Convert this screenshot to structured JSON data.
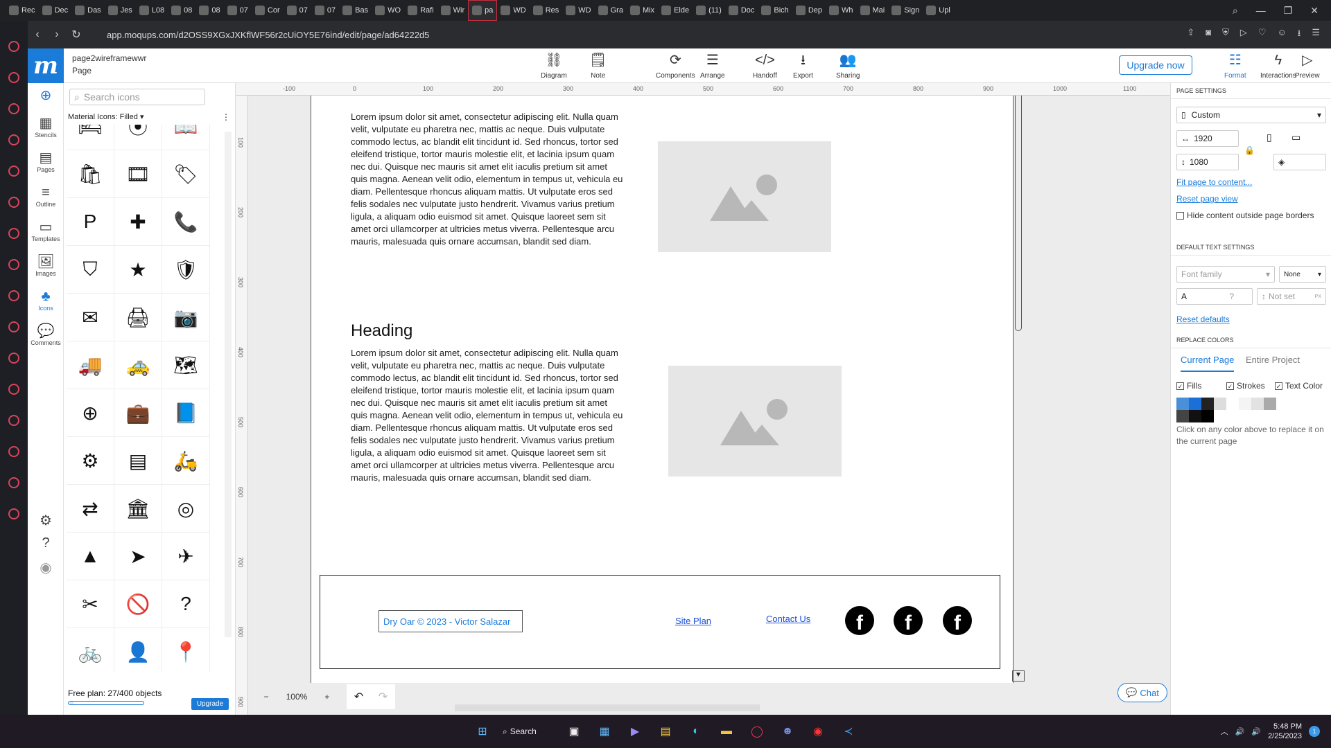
{
  "browser": {
    "tabs": [
      "Rec",
      "Dec",
      "Das",
      "Jes",
      "L08",
      "08",
      "08",
      "07",
      "Cor",
      "07",
      "07",
      "Bas",
      "WO",
      "Rafi",
      "Wir",
      "pa",
      "WD",
      "Res",
      "WD",
      "Gra",
      "Mix",
      "Elde",
      "(11)",
      "Doc",
      "Bich",
      "Dep",
      "Wh",
      "Mai",
      "Sign",
      "Upl"
    ],
    "active_tab_index": 15,
    "url": "app.moqups.com/d2OSS9XGxJXKflWF56r2cUiOY5E76ind/edit/page/ad64222d5"
  },
  "app": {
    "logo": "m",
    "project_name": "page2wireframewwr",
    "page_label": "Page",
    "toolbar": [
      {
        "label": "Diagram",
        "icon": "⛓"
      },
      {
        "label": "Note",
        "icon": "🗒"
      },
      {
        "label": "Components",
        "icon": "⟳"
      },
      {
        "label": "Arrange",
        "icon": "☰"
      },
      {
        "label": "Handoff",
        "icon": "</>"
      },
      {
        "label": "Export",
        "icon": "⭳"
      },
      {
        "label": "Sharing",
        "icon": "👥"
      }
    ],
    "upgrade_button": "Upgrade now",
    "right_tools": [
      {
        "label": "Format",
        "icon": "☷"
      },
      {
        "label": "Interactions",
        "icon": "ϟ"
      },
      {
        "label": "Preview",
        "icon": "▷"
      }
    ]
  },
  "rail": {
    "items": [
      {
        "label": "Stencils",
        "icon": "▦"
      },
      {
        "label": "Pages",
        "icon": "▤"
      },
      {
        "label": "Outline",
        "icon": "≡"
      },
      {
        "label": "Templates",
        "icon": "▭"
      },
      {
        "label": "Images",
        "icon": "🖼"
      },
      {
        "label": "Icons",
        "icon": "♣"
      },
      {
        "label": "Comments",
        "icon": "💬"
      }
    ]
  },
  "icon_panel": {
    "search_placeholder": "Search icons",
    "library": "Material Icons: Filled",
    "icons": [
      "🛏",
      "⦿",
      "📖",
      "🛍",
      "🎞",
      "🏷",
      "P",
      "✚",
      "📞",
      "⛉",
      "★",
      "🛡",
      "✉",
      "🖨",
      "📷",
      "🚚",
      "🚕",
      "🗺",
      "⊕",
      "💼",
      "📘",
      "⚙",
      "▤",
      "🛵",
      "⇄",
      "🏛",
      "◎",
      "▲",
      "➤",
      "✈",
      "✂",
      "🚫",
      "?",
      "🚲",
      "👤",
      "📍"
    ],
    "free_plan": "Free plan: 27/400 objects",
    "free_plan_fraction": 0.0675,
    "upgrade": "Upgrade"
  },
  "canvas": {
    "ruler_h": [
      "-100",
      "0",
      "100",
      "200",
      "300",
      "400",
      "500",
      "600",
      "700",
      "800",
      "900",
      "1000",
      "1100"
    ],
    "ruler_v": [
      "100",
      "200",
      "300",
      "400",
      "500",
      "600",
      "700",
      "800",
      "900"
    ],
    "lorem": "Lorem ipsum dolor sit amet, consectetur adipiscing elit. Nulla quam velit, vulputate eu pharetra nec, mattis ac neque. Duis vulputate commodo lectus, ac blandit elit tincidunt id. Sed rhoncus, tortor sed eleifend tristique, tortor mauris molestie elit, et lacinia ipsum quam nec dui. Quisque nec mauris sit amet elit iaculis pretium sit amet quis magna. Aenean velit odio, elementum in tempus ut, vehicula eu diam. Pellentesque rhoncus aliquam mattis. Ut vulputate eros sed felis sodales nec vulputate justo hendrerit. Vivamus varius pretium ligula, a aliquam odio euismod sit amet. Quisque laoreet sem sit amet orci ullamcorper at ultricies metus viverra. Pellentesque arcu mauris, malesuada quis ornare accumsan, blandit sed diam.",
    "heading": "Heading",
    "footer": {
      "copyright": "Dry Oar © 2023 - Victor Salazar",
      "site_plan": "Site Plan",
      "contact": "Contact Us",
      "social_glyph": "f"
    },
    "zoom": "100%",
    "chat": "Chat"
  },
  "right_panel": {
    "page_settings": "PAGE SETTINGS",
    "size_preset": "Custom",
    "width": "1920",
    "height": "1080",
    "fit_link": "Fit page to content...",
    "reset_link": "Reset page view",
    "hide_label": "Hide content outside page borders",
    "text_settings": "DEFAULT TEXT SETTINGS",
    "font_family": "Font family",
    "font_weight": "None",
    "font_size": "?",
    "line_height": "Not set",
    "line_height_unit": "PX",
    "reset_defaults": "Reset defaults",
    "replace_colors": "REPLACE COLORS",
    "tab_current": "Current Page",
    "tab_project": "Entire Project",
    "fills": "Fills",
    "strokes": "Strokes",
    "text_color": "Text Color",
    "swatches": [
      "#4a90d9",
      "#1b6fd9",
      "#222222",
      "#dddddd",
      "#ffffff",
      "#f4f4f4",
      "#e2e2e2",
      "#aaaaaa",
      "#444444",
      "#111111",
      "#000000"
    ],
    "hint": "Click on any color above to replace it on the current page"
  },
  "taskbar": {
    "search": "Search",
    "time": "5:48 PM",
    "date": "2/25/2023",
    "notification": "1"
  }
}
